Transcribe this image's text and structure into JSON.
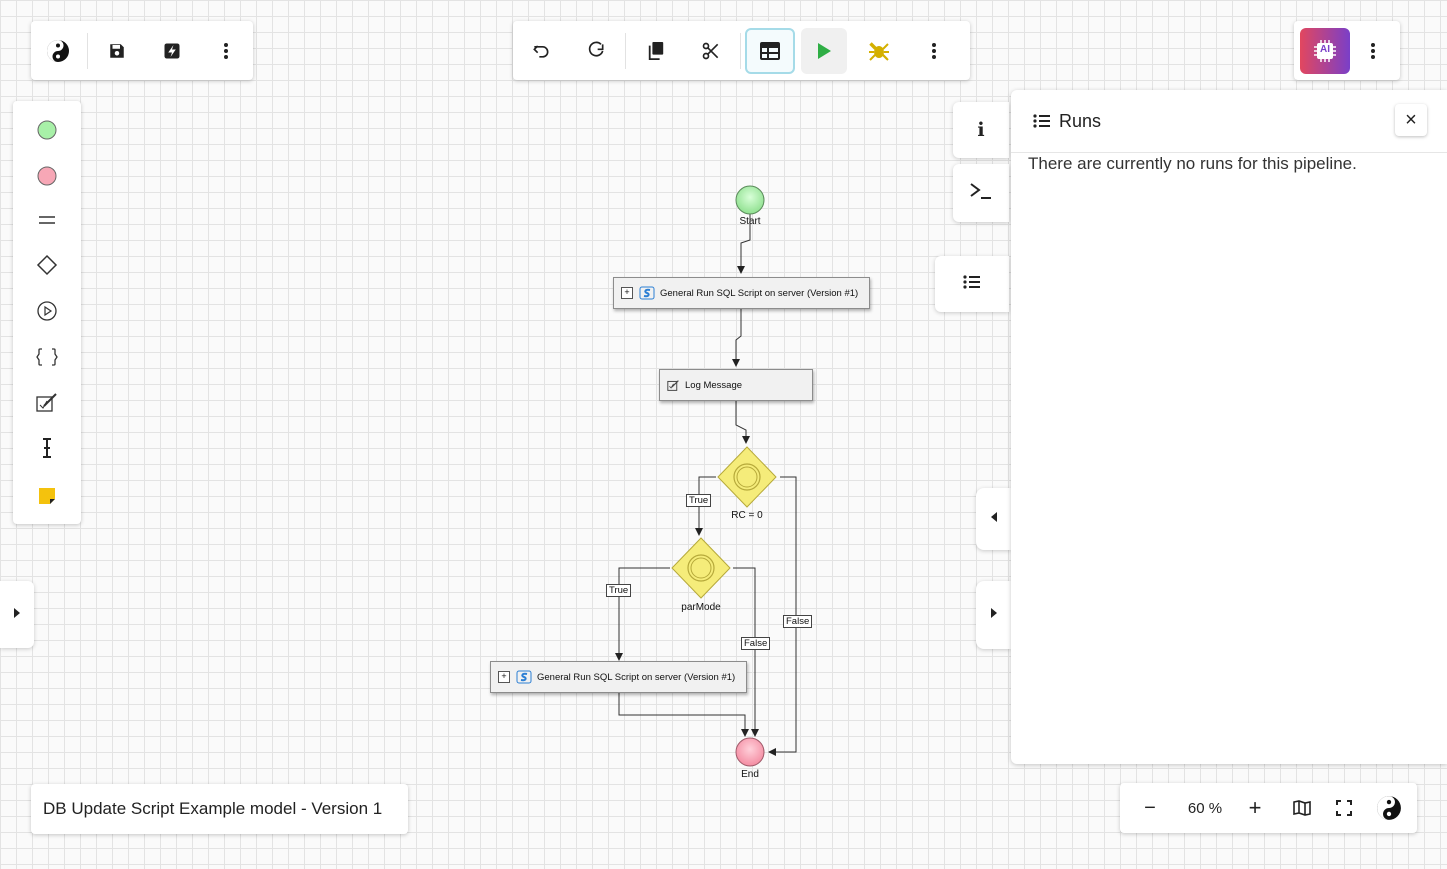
{
  "colors": {
    "accent": "#21a0c0",
    "play": "#2fae45",
    "debug": "#d4b000",
    "start_node": "#a8f0a8",
    "end_node": "#f7a7b6",
    "gateway": "#f5e96a"
  },
  "toolbar_left": {
    "icons": [
      "logo-icon",
      "save-icon",
      "deploy-icon",
      "more-vertical-icon"
    ]
  },
  "toolbar_main": {
    "icons": [
      "undo-icon",
      "redo-icon",
      "copy-icon",
      "cut-icon",
      "table-icon",
      "play-icon",
      "debug-icon",
      "more-vertical-icon"
    ]
  },
  "toolbar_right": {
    "ai_label": "AI",
    "icons": [
      "ai-chip-icon",
      "more-vertical-icon"
    ]
  },
  "palette": {
    "items": [
      "start-event-icon",
      "end-event-icon",
      "task-icon",
      "gateway-icon",
      "subprocess-icon",
      "group-icon",
      "annotation-icon",
      "text-cursor-icon",
      "sticky-note-icon"
    ]
  },
  "side_tabs": {
    "info_label": "i",
    "terminal_label": ">_"
  },
  "runs_panel": {
    "title": "Runs",
    "message": "There are currently no runs for this pipeline.",
    "close_label": "×"
  },
  "diagram": {
    "start_label": "Start",
    "end_label": "End",
    "task1_label": "General Run SQL Script on server (Version #1)",
    "task2_label": "Log Message",
    "task3_label": "General Run SQL Script on server (Version #1)",
    "gateway1_label": "RC = 0",
    "gateway2_label": "parMode",
    "flow_true_1": "True",
    "flow_true_2": "True",
    "flow_false_1": "False",
    "flow_false_2": "False"
  },
  "model_name": "DB Update Script Example model - Version 1",
  "zoom": {
    "minus_label": "−",
    "value": "60 %",
    "plus_label": "+"
  }
}
